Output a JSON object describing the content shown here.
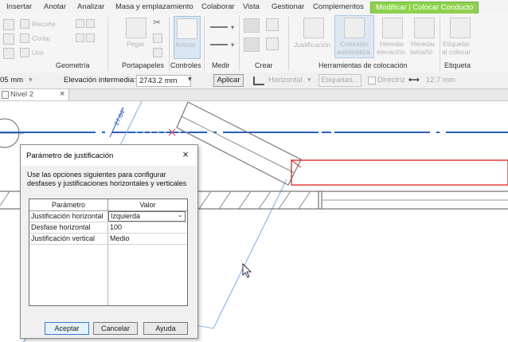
{
  "tabs": [
    "Insertar",
    "Anotar",
    "Analizar",
    "Masa y emplazamiento",
    "Colaborar",
    "Vista",
    "Gestionar",
    "Complementos",
    "Modificar | Colocar Conducto"
  ],
  "ribbon": {
    "geometry": {
      "label": "Geometría",
      "items": [
        "Recorte",
        "Cortar",
        "Unir"
      ]
    },
    "clipboard": {
      "label": "Portapapeles",
      "paste": "Pegar"
    },
    "controls": {
      "label": "Controles",
      "activate": "Activar"
    },
    "measure": {
      "label": "Medir"
    },
    "create": {
      "label": "Crear"
    },
    "placement": {
      "label": "Herramientas de colocación",
      "justify": "Justificación",
      "auto_connect_1": "Conexión",
      "auto_connect_2": "automática",
      "inherit_elev_1": "Heredar",
      "inherit_elev_2": "elevación",
      "inherit_size_1": "Heredar",
      "inherit_size_2": "tamaño"
    },
    "tag": {
      "label": "Etiqueta",
      "tag_1": "Etiquetar",
      "tag_2": "al colocar"
    }
  },
  "options_bar": {
    "left_value": "05 mm",
    "elevation_label": "Elevación intermedia:",
    "elevation_value": "2743.2 mm",
    "apply": "Aplicar",
    "orientation": "Horizontal",
    "tags": "Etiquetas...",
    "directriz": "Directriz",
    "length": "12.7 mm"
  },
  "view_tab": {
    "name": "Nivel 2"
  },
  "canvas": {
    "angle_label": "27.64°"
  },
  "dialog": {
    "title": "Parámetro de justificación",
    "description": "Use las opciones siguientes para configurar desfases y justificaciones horizontales y verticales",
    "col_param": "Parámetro",
    "col_value": "Valor",
    "rows": [
      {
        "param": "Justificación horizontal",
        "value": "Izquierda"
      },
      {
        "param": "Desfase horizontal",
        "value": "100"
      },
      {
        "param": "Justificación vertical",
        "value": "Medio"
      }
    ],
    "ok": "Aceptar",
    "cancel": "Cancelar",
    "help": "Ayuda"
  }
}
